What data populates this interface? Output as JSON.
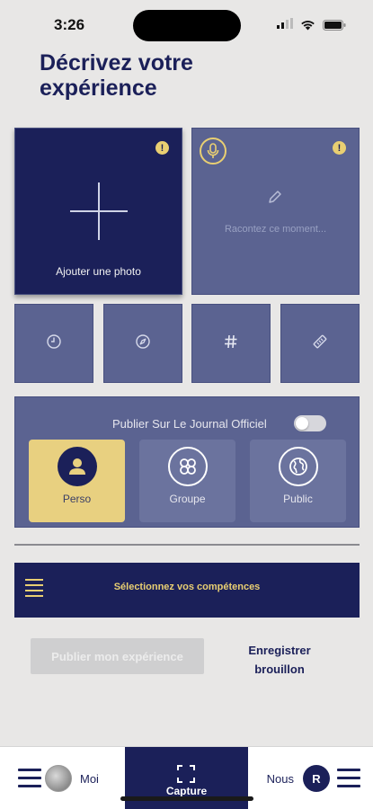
{
  "status": {
    "time": "3:26"
  },
  "page": {
    "title": "Décrivez votre expérience"
  },
  "media": {
    "photo_label": "Ajouter une photo",
    "story_placeholder": "Racontez ce moment...",
    "warning_glyph": "!"
  },
  "tools": [
    {
      "name": "clock-icon"
    },
    {
      "name": "compass-icon"
    },
    {
      "name": "hashtag-icon"
    },
    {
      "name": "tag-icon"
    }
  ],
  "publish": {
    "journal_label": "Publier Sur Le Journal Officiel",
    "journal_enabled": false,
    "options": [
      {
        "label": "Perso",
        "selected": true
      },
      {
        "label": "Groupe",
        "selected": false
      },
      {
        "label": "Public",
        "selected": false
      }
    ]
  },
  "skills": {
    "label": "Sélectionnez vos compétences"
  },
  "actions": {
    "publish_label": "Publier mon expérience",
    "draft_line1": "Enregistrer",
    "draft_line2": "brouillon"
  },
  "tabbar": {
    "moi_label": "Moi",
    "capture_label": "Capture",
    "nous_label": "Nous",
    "avatar_initial": "R"
  },
  "colors": {
    "navy": "#1b2059",
    "slate": "#5b6391",
    "gold": "#e9cf72",
    "selected": "#e8d080",
    "background": "#e8e7e6"
  }
}
